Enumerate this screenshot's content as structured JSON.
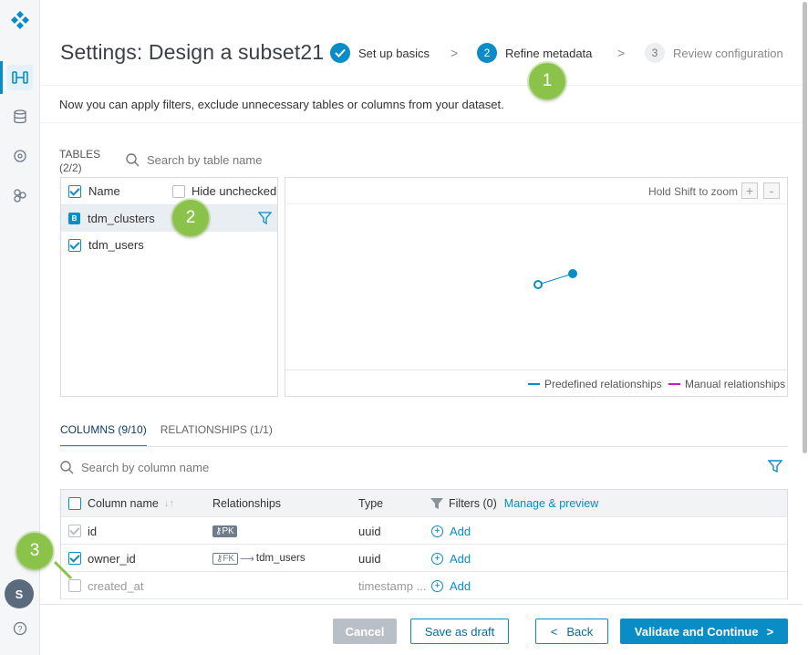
{
  "header": {
    "title": "Settings: Design a subset21",
    "steps": [
      {
        "num": "✓",
        "label": "Set up basics",
        "state": "done"
      },
      {
        "num": "2",
        "label": "Refine metadata",
        "state": "active"
      },
      {
        "num": "3",
        "label": "Review configuration",
        "state": "pending"
      }
    ],
    "chevron": ">"
  },
  "subtitle": "Now you can apply filters, exclude unnecessary tables or columns from your dataset.",
  "markers": [
    "1",
    "2",
    "3"
  ],
  "tables": {
    "label_line1": "TABLES",
    "label_line2": "(2/2)",
    "search_placeholder": "Search by table name",
    "name_header": "Name",
    "hide_unchecked": "Hide unchecked",
    "rows": [
      {
        "name": "tdm_clusters",
        "badge": "B",
        "selected": true
      },
      {
        "name": "tdm_users",
        "checked": true
      }
    ]
  },
  "graph": {
    "zoom_hint": "Hold Shift to zoom",
    "zoom_in": "+",
    "zoom_out": "-",
    "legend": [
      {
        "label": "Predefined relationships",
        "color": "#0a8cc6"
      },
      {
        "label": "Manual relationships",
        "color": "#c21fc2"
      }
    ]
  },
  "tabs": [
    {
      "label": "COLUMNS (9/10)",
      "active": true
    },
    {
      "label": "RELATIONSHIPS (1/1)",
      "active": false
    }
  ],
  "columns": {
    "search_placeholder": "Search by column name",
    "headers": {
      "column_name": "Column name",
      "sort_icon": "↓↑",
      "relationships": "Relationships",
      "type": "Type",
      "filters": "Filters (0)",
      "manage": "Manage & preview"
    },
    "rows": [
      {
        "name": "id",
        "rel_key": "PK",
        "type": "uuid",
        "add": "Add",
        "checked": true,
        "locked": true
      },
      {
        "name": "owner_id",
        "rel_key": "FK",
        "rel_target": "tdm_users",
        "type": "uuid",
        "add": "Add",
        "checked": true
      },
      {
        "name": "created_at",
        "type": "timestamp ...",
        "add": "Add",
        "checked": false
      }
    ]
  },
  "footer": {
    "cancel": "Cancel",
    "save_draft": "Save as draft",
    "back": "Back",
    "validate": "Validate and Continue"
  },
  "user": {
    "initial": "S"
  },
  "colors": {
    "accent": "#0a8cc6",
    "marker": "#8bc34a"
  }
}
